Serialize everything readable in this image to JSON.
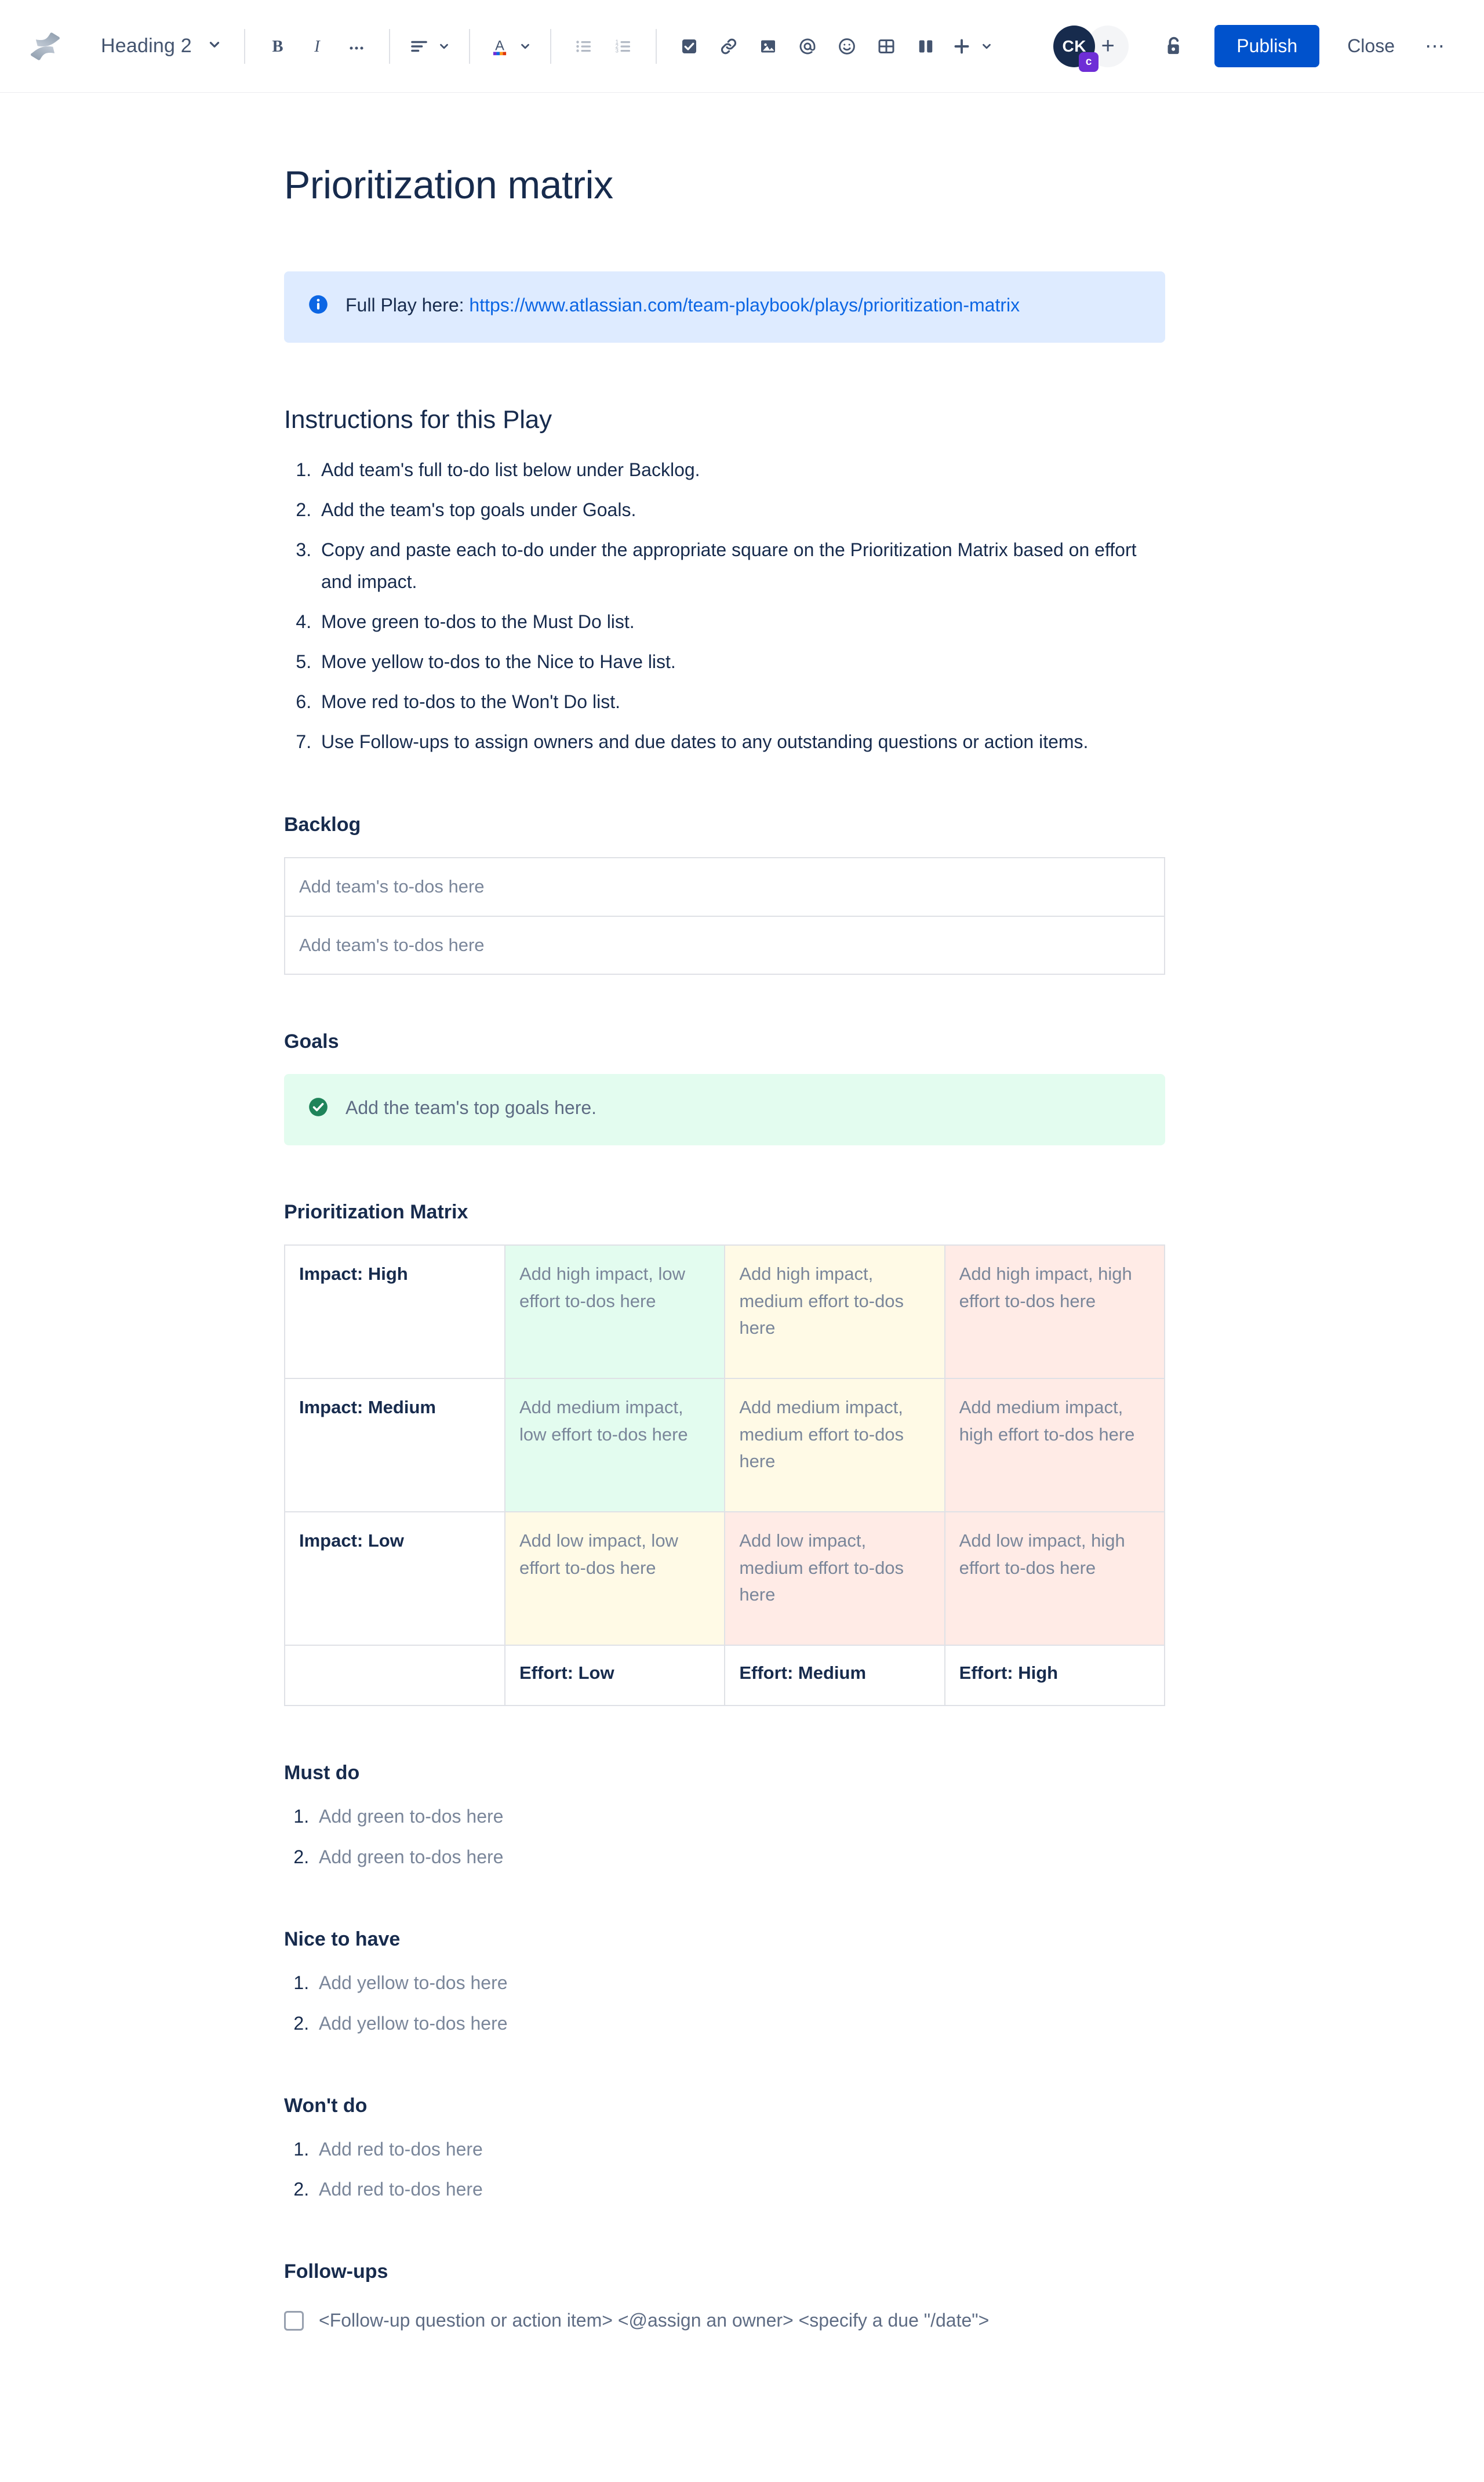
{
  "toolbar": {
    "logo_name": "atlassian-confluence-logo",
    "block_type": {
      "label": "Heading 2"
    },
    "buttons": [
      {
        "name": "bold",
        "label": "B"
      },
      {
        "name": "italic",
        "label": "I"
      },
      {
        "name": "more-formatting",
        "label": "…"
      },
      {
        "name": "text-align",
        "label": "Text alignment"
      },
      {
        "name": "text-color",
        "label": "A"
      },
      {
        "name": "bulleted-list",
        "label": "Bulleted list"
      },
      {
        "name": "numbered-list",
        "label": "Numbered list"
      },
      {
        "name": "action-item",
        "label": "Action item"
      },
      {
        "name": "link",
        "label": "Link"
      },
      {
        "name": "image",
        "label": "Image"
      },
      {
        "name": "mention",
        "label": "Mention"
      },
      {
        "name": "emoji",
        "label": "Emoji"
      },
      {
        "name": "table",
        "label": "Table"
      },
      {
        "name": "layout",
        "label": "Layout"
      },
      {
        "name": "insert-more",
        "label": "Insert more"
      }
    ],
    "avatar": {
      "initials": "CK",
      "badge": "c"
    },
    "add_person_label": "+",
    "restrictions_label": "Restrictions",
    "publish_label": "Publish",
    "close_label": "Close",
    "more_label": "⋯"
  },
  "document": {
    "title": "Prioritization matrix",
    "info_panel": {
      "prefix": "Full Play here: ",
      "link_text": "https://www.atlassian.com/team-playbook/plays/prioritization-matrix"
    },
    "instructions": {
      "heading": "Instructions for this Play",
      "items": [
        "Add team's full to-do list below under Backlog.",
        "Add the team's top goals under Goals.",
        "Copy and paste each to-do under the appropriate square on the Prioritization Matrix based on effort and impact.",
        "Move green to-dos to the Must Do list.",
        "Move yellow to-dos to the Nice to Have list.",
        "Move red to-dos to the Won't Do list.",
        "Use Follow-ups to assign owners and due dates to any outstanding questions or action items."
      ]
    },
    "backlog": {
      "heading": "Backlog",
      "rows": [
        "Add team's to-dos here",
        "Add team's to-dos here"
      ]
    },
    "goals": {
      "heading": "Goals",
      "panel_text": "Add the team's top goals here."
    },
    "matrix": {
      "heading": "Prioritization Matrix",
      "rows": [
        {
          "label": "Impact: High",
          "cells": [
            {
              "text": "Add high impact, low effort to-dos here",
              "color": "green"
            },
            {
              "text": "Add high impact, medium effort to-dos here",
              "color": "yellow"
            },
            {
              "text": "Add high impact, high effort to-dos here",
              "color": "red"
            }
          ]
        },
        {
          "label": "Impact: Medium",
          "cells": [
            {
              "text": "Add medium impact, low effort to-dos here",
              "color": "green"
            },
            {
              "text": "Add medium impact, medium effort to-dos here",
              "color": "yellow"
            },
            {
              "text": "Add medium impact, high effort to-dos here",
              "color": "red"
            }
          ]
        },
        {
          "label": "Impact: Low",
          "cells": [
            {
              "text": "Add low impact, low effort to-dos here",
              "color": "yellow"
            },
            {
              "text": "Add low impact, medium effort to-dos here",
              "color": "red"
            },
            {
              "text": "Add low impact, high effort to-dos here",
              "color": "red"
            }
          ]
        }
      ],
      "footer": {
        "label": "",
        "cells": [
          "Effort: Low",
          "Effort: Medium",
          "Effort: High"
        ]
      }
    },
    "must_do": {
      "heading": "Must do",
      "items": [
        "Add green to-dos here",
        "Add green to-dos here"
      ]
    },
    "nice_to_have": {
      "heading": "Nice to have",
      "items": [
        "Add yellow to-dos here",
        "Add yellow to-dos here"
      ]
    },
    "wont_do": {
      "heading": "Won't do",
      "items": [
        "Add red to-dos here",
        "Add red to-dos here"
      ]
    },
    "follow_ups": {
      "heading": "Follow-ups",
      "item": "<Follow-up question or action item> <@assign an owner> <specify a due \"/date\">"
    }
  },
  "colors": {
    "accent_blue": "#0052cc",
    "link_blue": "#0c66e4",
    "info_panel_bg": "#deebff",
    "success_panel_bg": "#e3fcef",
    "cell_green": "#e3fcef",
    "cell_yellow": "#fffae6",
    "cell_red": "#ffebe6",
    "text_primary": "#172b4d",
    "text_placeholder": "#7a869a",
    "border": "#dfe1e6"
  }
}
